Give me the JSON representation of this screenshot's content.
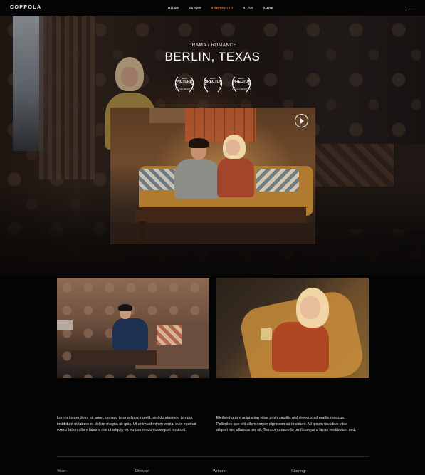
{
  "header": {
    "logo": "COPPOLA",
    "nav": [
      {
        "label": "HOME"
      },
      {
        "label": "PAGES"
      },
      {
        "label": "PORTFOLIO",
        "active": true
      },
      {
        "label": "BLOG"
      },
      {
        "label": "SHOP"
      }
    ],
    "menu_icon": "hamburger-icon"
  },
  "hero": {
    "genre": "DRAMA / ROMANCE",
    "title": "BERLIN, TEXAS",
    "awards": [
      {
        "top": "BEST",
        "main": "PICTURE",
        "foot": "OFFICIAL SELECTION"
      },
      {
        "top": "BEST",
        "main": "DIRECTOR",
        "foot": ""
      },
      {
        "top": "BEST",
        "main": "DIRECTOR",
        "foot": "OFFICIAL SELECTION"
      }
    ],
    "play_icon": "play-icon"
  },
  "content": {
    "paragraph_left": "Lorem ipsum dolor sit amet, consec tetur adipiscing elit, sed do eiusmod tempor incididunt ut labore et dolore magna ali quis. Ut enim ad minim venia, quis nostrud exerci tation ullam laboris nisi ut aliquip ex ea commodo consequat nostrudi.",
    "paragraph_right": "Eleifend quam adipiscing vitae proin sagittis nisl rhoncus ad mattis rhoncus. Pellentes que elit ullam corper dignissim ad tincidunt. Mi ipsum faucibus vitae aliquet nec ullamcorper sit. Tempor commodo profibusque a lacus vestibulum sed."
  },
  "meta": {
    "year_label": "Year:",
    "director_label": "Director:",
    "writers_label": "Writers:",
    "starring_label": "Starring:"
  },
  "colors": {
    "accent": "#d7733c",
    "background": "#040404"
  }
}
